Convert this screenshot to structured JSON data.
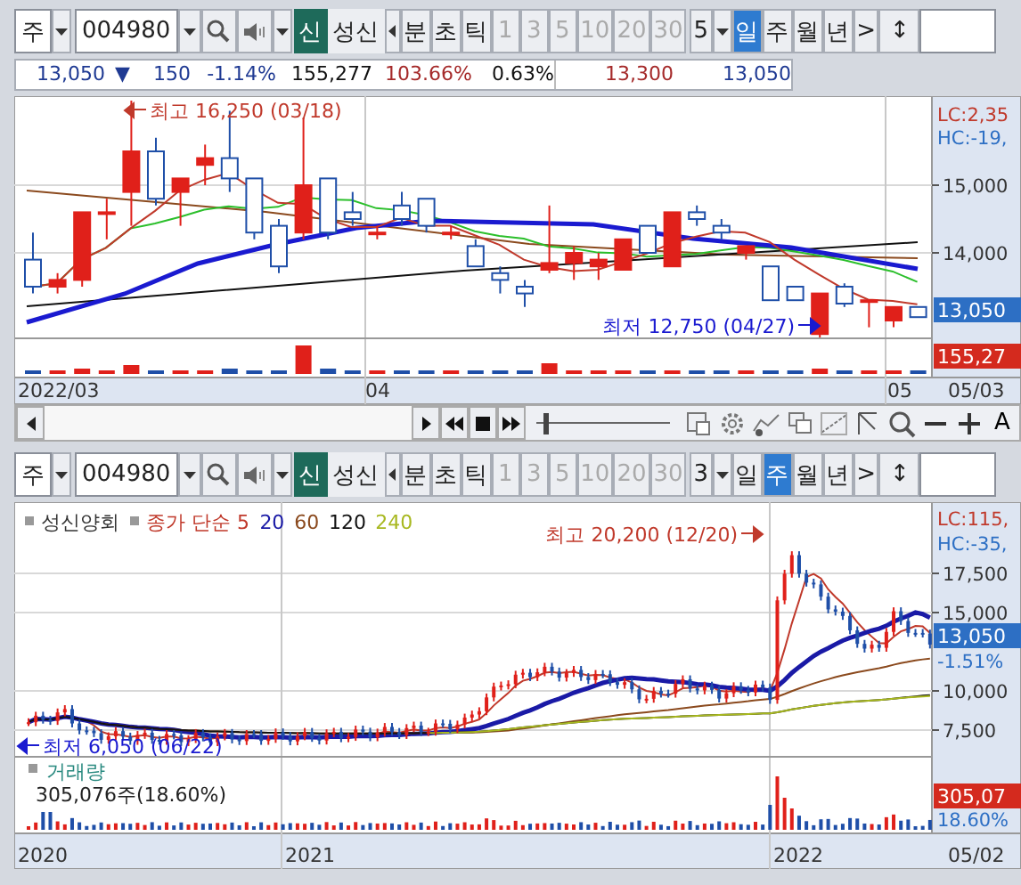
{
  "panels": [
    {
      "toolbar": {
        "market": "주",
        "code": "004980",
        "badge": "신",
        "name": "성신",
        "modes": [
          "분",
          "초",
          "틱"
        ],
        "intervals": [
          {
            "label": "1",
            "disabled": true
          },
          {
            "label": "3",
            "disabled": true
          },
          {
            "label": "5",
            "disabled": true
          },
          {
            "label": "10",
            "disabled": true
          },
          {
            "label": "20",
            "disabled": true
          },
          {
            "label": "30",
            "disabled": true
          }
        ],
        "count": "5",
        "units": [
          {
            "label": "일",
            "selected": true
          },
          {
            "label": "주",
            "selected": false
          },
          {
            "label": "월",
            "selected": false
          },
          {
            "label": "년",
            "selected": false
          }
        ],
        "next": ">",
        "resize": "↕"
      },
      "quote": [
        {
          "text": "13,050",
          "color": "#1f3a93"
        },
        {
          "text": "▼",
          "color": "#1f3a93"
        },
        {
          "text": "150",
          "color": "#1f3a93"
        },
        {
          "text": "-1.14%",
          "color": "#1f3a93"
        },
        {
          "text": "155,277",
          "color": "#111111"
        },
        {
          "text": "103.66%",
          "color": "#a52a2a"
        },
        {
          "text": "0.63%",
          "color": "#111111"
        },
        {
          "text": "13,300",
          "color": "#a52a2a"
        },
        {
          "text": "13,050",
          "color": "#1f3a93"
        }
      ],
      "chart": {
        "kind": "daily",
        "axis_labels": [
          {
            "text": "LC:2,35",
            "kind": "lc"
          },
          {
            "text": "HC:-19,",
            "kind": "hc"
          },
          {
            "text": "15,000",
            "kind": "tick"
          },
          {
            "text": "14,000",
            "kind": "tick"
          },
          {
            "text": "13,050",
            "kind": "price_badge"
          },
          {
            "text": "155,27",
            "kind": "volume_badge"
          }
        ],
        "annotations": [
          {
            "text": "최고 16,250 (03/18)",
            "kind": "high"
          },
          {
            "text": "최저 12,750 (04/27)",
            "kind": "low"
          }
        ],
        "x_labels": [
          "2022/03",
          "04",
          "05",
          "05/03"
        ]
      },
      "nav": {
        "slider": {
          "level": 0.05
        },
        "text_button": "A"
      }
    },
    {
      "toolbar": {
        "market": "주",
        "code": "004980",
        "badge": "신",
        "name": "성신",
        "modes": [
          "분",
          "초",
          "틱"
        ],
        "intervals": [
          {
            "label": "1",
            "disabled": true
          },
          {
            "label": "3",
            "disabled": true
          },
          {
            "label": "5",
            "disabled": true
          },
          {
            "label": "10",
            "disabled": true
          },
          {
            "label": "20",
            "disabled": true
          },
          {
            "label": "30",
            "disabled": true
          }
        ],
        "count": "3",
        "units": [
          {
            "label": "일",
            "selected": false
          },
          {
            "label": "주",
            "selected": true
          },
          {
            "label": "월",
            "selected": false
          },
          {
            "label": "년",
            "selected": false
          }
        ],
        "next": ">",
        "resize": "↕"
      },
      "chart": {
        "kind": "weekly",
        "legend": [
          {
            "text": "성신양회",
            "color": "#333333"
          },
          {
            "text": "종가 단순 5",
            "color": "#c0392b"
          },
          {
            "text": "20",
            "color": "#1a1aa6"
          },
          {
            "text": "60",
            "color": "#8b4a1e"
          },
          {
            "text": "120",
            "color": "#111111"
          },
          {
            "text": "240",
            "color": "#a8b820"
          }
        ],
        "axis_labels": [
          {
            "text": "LC:115,",
            "kind": "lc"
          },
          {
            "text": "HC:-35,",
            "kind": "hc"
          },
          {
            "text": "17,500",
            "kind": "tick"
          },
          {
            "text": "15,000",
            "kind": "tick"
          },
          {
            "text": "13,050",
            "kind": "price_badge"
          },
          {
            "text": "-1.51%",
            "kind": "rate"
          },
          {
            "text": "10,000",
            "kind": "tick"
          },
          {
            "text": "7,500",
            "kind": "tick"
          },
          {
            "text": "305,07",
            "kind": "volume_badge"
          },
          {
            "text": "18.60%",
            "kind": "volume_rate"
          }
        ],
        "annotations": [
          {
            "text": "최고 20,200 (12/20)",
            "kind": "high"
          },
          {
            "text": "최저 6,050 (06/22)",
            "kind": "low"
          }
        ],
        "volume": {
          "title": "거래량",
          "value": "305,076주(18.60%)"
        },
        "x_labels": [
          "2020",
          "2021",
          "2022",
          "05/02"
        ]
      }
    }
  ]
}
